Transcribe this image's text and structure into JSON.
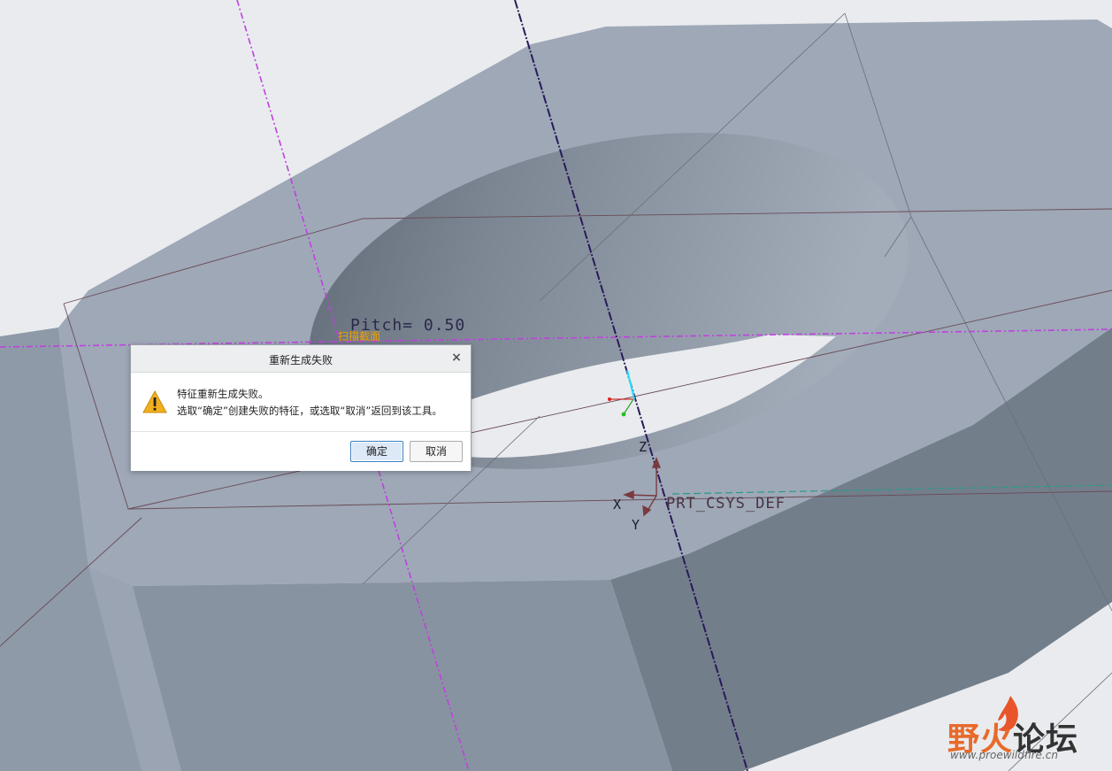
{
  "viewport": {
    "annotations": {
      "pitch": "Pitch= 0.50",
      "section": "扫描截面",
      "csys": "PRT_CSYS_DEF",
      "axis_x": "X",
      "axis_y": "Y",
      "axis_z": "Z"
    },
    "colors": {
      "background": "#e9ebee",
      "body_top": "#9ea8b7",
      "body_side": "#8b96a4",
      "body_dark": "#737e8b",
      "datum_axis_magenta": "#c040e0",
      "datum_axis_navy": "#2a1a5a"
    }
  },
  "dialog": {
    "title": "重新生成失败",
    "close_label": "×",
    "icon": "warning-icon",
    "message_line1": "特征重新生成失败。",
    "message_line2": "选取“确定”创建失败的特征，或选取“取消”返回到该工具。",
    "ok_label": "确定",
    "cancel_label": "取消"
  },
  "watermark": {
    "brand_colored": "野火",
    "brand_dark": "论坛",
    "url": "www.proewildfire.cn"
  }
}
